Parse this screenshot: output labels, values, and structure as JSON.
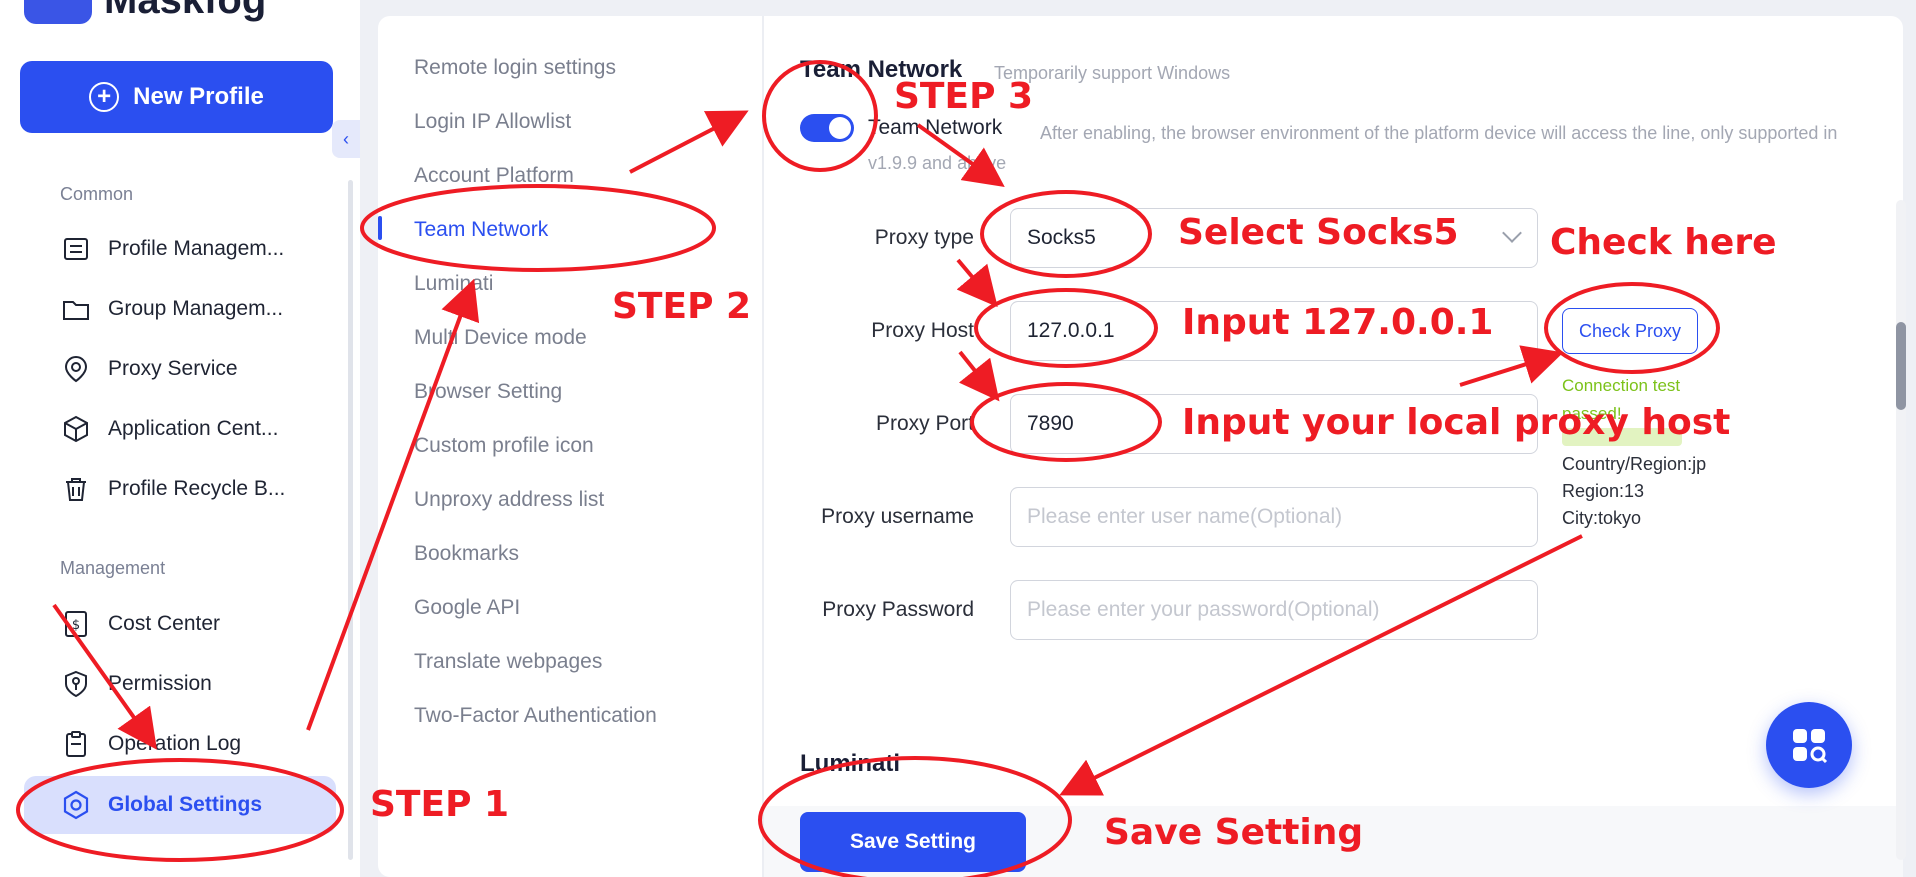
{
  "app": {
    "logo_text": "Maskfog"
  },
  "sidebar": {
    "new_profile": "New Profile",
    "sections": {
      "common": "Common",
      "management": "Management"
    },
    "common_items": [
      {
        "label": "Profile Managem...",
        "icon": "profile-list-icon"
      },
      {
        "label": "Group Managem...",
        "icon": "folder-icon"
      },
      {
        "label": "Proxy Service",
        "icon": "location-pin-icon"
      },
      {
        "label": "Application Cent...",
        "icon": "cube-icon"
      },
      {
        "label": "Profile Recycle B...",
        "icon": "trash-icon"
      }
    ],
    "management_items": [
      {
        "label": "Cost Center",
        "icon": "dollar-document-icon"
      },
      {
        "label": "Permission",
        "icon": "shield-key-icon"
      },
      {
        "label": "Operation Log",
        "icon": "clipboard-icon"
      },
      {
        "label": "Global Settings",
        "icon": "hexagon-settings-icon"
      }
    ]
  },
  "settings_nav": {
    "items": [
      "Remote login settings",
      "Login IP Allowlist",
      "Account Platform",
      "Team Network",
      "Luminati",
      "Multi Device mode",
      "Browser Setting",
      "Custom profile icon",
      "Unproxy address list",
      "Bookmarks",
      "Google API",
      "Translate webpages",
      "Two-Factor Authentication"
    ],
    "active": "Team Network"
  },
  "team_network": {
    "title": "Team Network",
    "subtitle": "Temporarily support Windows",
    "toggle_label": "Team Network",
    "toggle_on": true,
    "toggle_desc": "After enabling, the browser environment of the platform device will access the line, only supported in v1.9.9 and above",
    "proxy_type_label": "Proxy type",
    "proxy_type_value": "Socks5",
    "proxy_host_label": "Proxy Host",
    "proxy_host_value": "127.0.0.1",
    "proxy_port_label": "Proxy Port",
    "proxy_port_value": "7890",
    "proxy_username_label": "Proxy username",
    "proxy_username_placeholder": "Please enter user name(Optional)",
    "proxy_password_label": "Proxy Password",
    "proxy_password_placeholder": "Please enter your password(Optional)",
    "check_proxy": "Check Proxy",
    "connection_status": "Connection test passed!",
    "country": "Country/Region:jp",
    "region": "Region:13",
    "city": "City:tokyo"
  },
  "luminati_title": "Luminati",
  "save_button": "Save Setting",
  "annotations": {
    "step1": "STEP 1",
    "step2": "STEP 2",
    "step3": "STEP 3",
    "select_socks": "Select Socks5",
    "input_host": "Input 127.0.0.1",
    "input_port": "Input your local proxy host",
    "check_here": "Check here",
    "save_setting": "Save Setting"
  },
  "colors": {
    "accent": "#2b4ff0",
    "annotation": "#ee1c24",
    "success": "#7cc21a"
  }
}
